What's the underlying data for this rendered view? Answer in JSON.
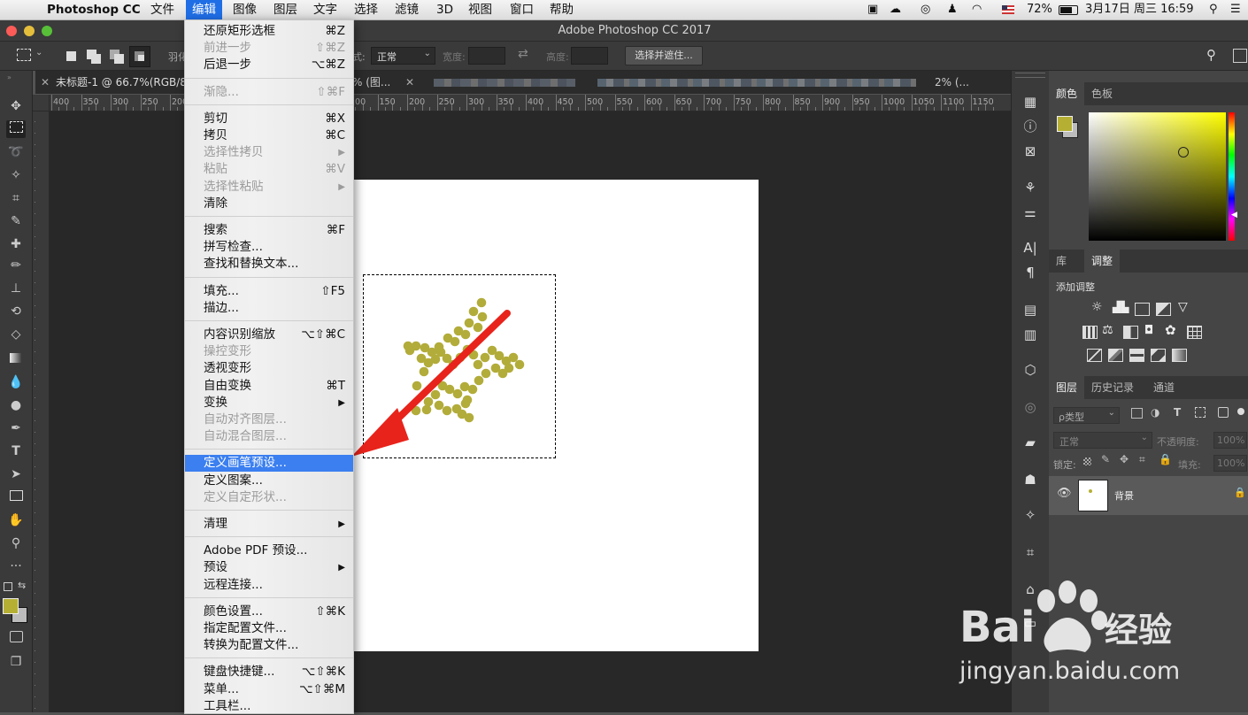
{
  "menubar": {
    "apple_icon": "apple-icon",
    "app_name": "Photoshop CC",
    "items": [
      "文件",
      "编辑",
      "图像",
      "图层",
      "文字",
      "选择",
      "滤镜",
      "3D",
      "视图",
      "窗口",
      "帮助"
    ],
    "active_index": 1,
    "status": {
      "battery": "72%",
      "datetime": "3月17日 周三  16:59"
    }
  },
  "window": {
    "title": "Adobe Photoshop CC 2017"
  },
  "options": {
    "feather_label": "羽化",
    "style_label": "式:",
    "style_value": "正常",
    "width_label": "宽度:",
    "height_label": "高度:",
    "select_mask_button": "选择并遮住..."
  },
  "tabs": [
    {
      "label": "未标题-1 @ 66.7%(RGB/8"
    },
    {
      "label": "% (图..."
    },
    {
      "label": "2% (..."
    }
  ],
  "ruler": {
    "top": [
      "400",
      "350",
      "300",
      "250",
      "200",
      "150",
      "100",
      "50",
      "0",
      "50",
      "100",
      "150",
      "200",
      "250",
      "300",
      "350",
      "400",
      "450",
      "500",
      "550",
      "600",
      "650",
      "700",
      "750",
      "800",
      "850",
      "900",
      "950",
      "1000",
      "1050",
      "1100",
      "1150"
    ]
  },
  "edit_menu": {
    "groups": [
      [
        {
          "label": "还原矩形选框",
          "shortcut": "⌘Z",
          "enabled": true
        },
        {
          "label": "前进一步",
          "shortcut": "⇧⌘Z",
          "enabled": false
        },
        {
          "label": "后退一步",
          "shortcut": "⌥⌘Z",
          "enabled": true
        }
      ],
      [
        {
          "label": "渐隐...",
          "shortcut": "⇧⌘F",
          "enabled": false
        }
      ],
      [
        {
          "label": "剪切",
          "shortcut": "⌘X",
          "enabled": true
        },
        {
          "label": "拷贝",
          "shortcut": "⌘C",
          "enabled": true
        },
        {
          "label": "选择性拷贝",
          "shortcut": "▶",
          "enabled": false
        },
        {
          "label": "粘贴",
          "shortcut": "⌘V",
          "enabled": false
        },
        {
          "label": "选择性粘贴",
          "shortcut": "▶",
          "enabled": false
        },
        {
          "label": "清除",
          "shortcut": "",
          "enabled": true
        }
      ],
      [
        {
          "label": "搜索",
          "shortcut": "⌘F",
          "enabled": true
        },
        {
          "label": "拼写检查...",
          "shortcut": "",
          "enabled": true
        },
        {
          "label": "查找和替换文本...",
          "shortcut": "",
          "enabled": true
        }
      ],
      [
        {
          "label": "填充...",
          "shortcut": "⇧F5",
          "enabled": true
        },
        {
          "label": "描边...",
          "shortcut": "",
          "enabled": true
        }
      ],
      [
        {
          "label": "内容识别缩放",
          "shortcut": "⌥⇧⌘C",
          "enabled": true
        },
        {
          "label": "操控变形",
          "shortcut": "",
          "enabled": false
        },
        {
          "label": "透视变形",
          "shortcut": "",
          "enabled": true
        },
        {
          "label": "自由变换",
          "shortcut": "⌘T",
          "enabled": true
        },
        {
          "label": "变换",
          "shortcut": "▶",
          "enabled": true
        },
        {
          "label": "自动对齐图层...",
          "shortcut": "",
          "enabled": false
        },
        {
          "label": "自动混合图层...",
          "shortcut": "",
          "enabled": false
        }
      ],
      [
        {
          "label": "定义画笔预设...",
          "shortcut": "",
          "enabled": true,
          "highlighted": true
        },
        {
          "label": "定义图案...",
          "shortcut": "",
          "enabled": true
        },
        {
          "label": "定义自定形状...",
          "shortcut": "",
          "enabled": false
        }
      ],
      [
        {
          "label": "清理",
          "shortcut": "▶",
          "enabled": true
        }
      ],
      [
        {
          "label": "Adobe PDF 预设...",
          "shortcut": "",
          "enabled": true
        },
        {
          "label": "预设",
          "shortcut": "▶",
          "enabled": true
        },
        {
          "label": "远程连接...",
          "shortcut": "",
          "enabled": true
        }
      ],
      [
        {
          "label": "颜色设置...",
          "shortcut": "⇧⌘K",
          "enabled": true
        },
        {
          "label": "指定配置文件...",
          "shortcut": "",
          "enabled": true
        },
        {
          "label": "转换为配置文件...",
          "shortcut": "",
          "enabled": true
        }
      ],
      [
        {
          "label": "键盘快捷键...",
          "shortcut": "⌥⇧⌘K",
          "enabled": true
        },
        {
          "label": "菜单...",
          "shortcut": "⌥⇧⌘M",
          "enabled": true
        },
        {
          "label": "工具栏...",
          "shortcut": "",
          "enabled": true
        }
      ]
    ]
  },
  "panels": {
    "color_tabs": [
      "颜色",
      "色板"
    ],
    "adjust_tabs": [
      "库",
      "调整"
    ],
    "add_adjustment_label": "添加调整",
    "layers_tabs": [
      "图层",
      "历史记录",
      "通道"
    ],
    "kind_filter": "ρ类型",
    "blend_mode": "正常",
    "opacity_label": "不透明度:",
    "opacity_value": "100%",
    "lock_label": "锁定:",
    "fill_label": "填充:",
    "fill_value": "100%",
    "layer_name": "背景"
  },
  "colors": {
    "foreground": "#b5b034",
    "background": "#bcbcbc",
    "brush_dots": "#b2ac3a",
    "arrow": "#e8231b",
    "menu_highlight": "#3b7ff0"
  },
  "watermark": {
    "logo_text": "Bai 经验",
    "url": "jingyan.baidu.com"
  }
}
